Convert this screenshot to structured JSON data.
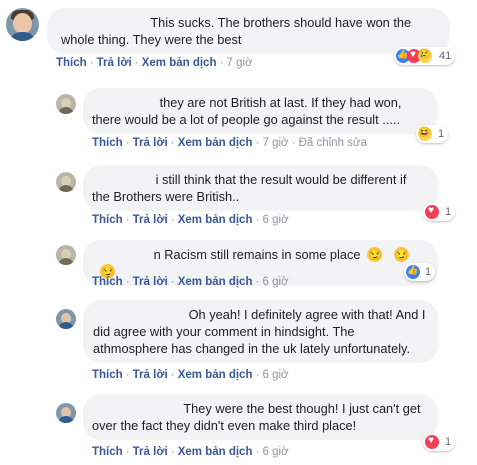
{
  "actions": {
    "like": "Thích",
    "reply": "Trả lời",
    "translate": "Xem bản dịch",
    "separator": "·",
    "edited": "Đã chỉnh sửa"
  },
  "comments": [
    {
      "text": "This sucks. The brothers should have won the whole thing. They were the best",
      "time": "7 giờ",
      "reactions": [
        "like-icon",
        "love-icon",
        "sad-icon"
      ],
      "count": "41"
    },
    {
      "text": "they are not British at last. If they had won, there would be a lot of people go against the result .....",
      "time": "7 giờ",
      "reactions": [
        "haha-icon"
      ],
      "count": "1"
    },
    {
      "text": "i still think that the result would be different if the Brothers were British..",
      "time": "6 giờ",
      "reactions": [
        "love-icon"
      ],
      "count": "1"
    },
    {
      "text": "n Racism still remains in some place",
      "emojis": 3,
      "time": "6 giờ",
      "reactions": [
        "like-icon"
      ],
      "count": "1"
    },
    {
      "text": "Oh yeah! I definitely agree with that! And I did agree with your comment in hindsight. The athmosphere has changed in the uk lately unfortunately.",
      "time": "6 giờ"
    },
    {
      "text": "They were the best though! I just can't get over the fact they didn't even make third place!",
      "time": "6 giờ",
      "reactions": [
        "love-icon"
      ],
      "count": "1"
    }
  ]
}
